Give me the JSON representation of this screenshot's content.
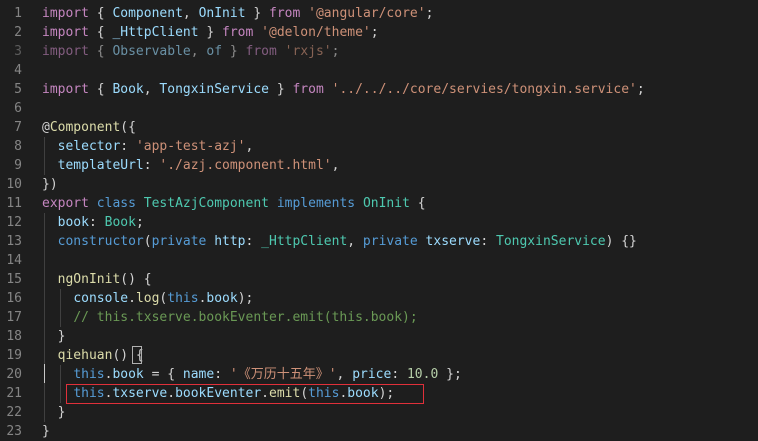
{
  "colors": {
    "background": "#1e1e1e",
    "line_number": "#858585",
    "keyword": "#569cd6",
    "control_keyword": "#c586c0",
    "string": "#ce9178",
    "type": "#4ec9b0",
    "variable": "#9cdcfe",
    "function": "#dcdcaa",
    "number": "#b5cea8",
    "comment": "#6a9955",
    "plain": "#d4d4d4",
    "highlight_box": "#e0303a"
  },
  "lines": [
    {
      "num": "1",
      "tokens": [
        {
          "t": "import",
          "c": "control_keyword"
        },
        {
          "t": " { ",
          "c": "plain"
        },
        {
          "t": "Component",
          "c": "variable"
        },
        {
          "t": ", ",
          "c": "plain"
        },
        {
          "t": "OnInit",
          "c": "variable"
        },
        {
          "t": " } ",
          "c": "plain"
        },
        {
          "t": "from",
          "c": "control_keyword"
        },
        {
          "t": " ",
          "c": "plain"
        },
        {
          "t": "'@angular/core'",
          "c": "string"
        },
        {
          "t": ";",
          "c": "plain"
        }
      ]
    },
    {
      "num": "2",
      "tokens": [
        {
          "t": "import",
          "c": "control_keyword"
        },
        {
          "t": " { ",
          "c": "plain"
        },
        {
          "t": "_HttpClient",
          "c": "variable"
        },
        {
          "t": " } ",
          "c": "plain"
        },
        {
          "t": "from",
          "c": "control_keyword"
        },
        {
          "t": " ",
          "c": "plain"
        },
        {
          "t": "'@delon/theme'",
          "c": "string"
        },
        {
          "t": ";",
          "c": "plain"
        }
      ]
    },
    {
      "num": "3",
      "dim": true,
      "tokens": [
        {
          "t": "import",
          "c": "control_keyword"
        },
        {
          "t": " { ",
          "c": "plain"
        },
        {
          "t": "Observable",
          "c": "variable"
        },
        {
          "t": ", ",
          "c": "plain"
        },
        {
          "t": "of",
          "c": "variable"
        },
        {
          "t": " } ",
          "c": "plain"
        },
        {
          "t": "from",
          "c": "control_keyword"
        },
        {
          "t": " ",
          "c": "plain"
        },
        {
          "t": "'rxjs'",
          "c": "string"
        },
        {
          "t": ";",
          "c": "plain"
        }
      ]
    },
    {
      "num": "4",
      "tokens": []
    },
    {
      "num": "5",
      "tokens": [
        {
          "t": "import",
          "c": "control_keyword"
        },
        {
          "t": " { ",
          "c": "plain"
        },
        {
          "t": "Book",
          "c": "variable"
        },
        {
          "t": ", ",
          "c": "plain"
        },
        {
          "t": "TongxinService",
          "c": "variable"
        },
        {
          "t": " } ",
          "c": "plain"
        },
        {
          "t": "from",
          "c": "control_keyword"
        },
        {
          "t": " ",
          "c": "plain"
        },
        {
          "t": "'../../../core/servies/tongxin.service'",
          "c": "string"
        },
        {
          "t": ";",
          "c": "plain"
        }
      ]
    },
    {
      "num": "6",
      "tokens": []
    },
    {
      "num": "7",
      "tokens": [
        {
          "t": "@",
          "c": "plain"
        },
        {
          "t": "Component",
          "c": "function"
        },
        {
          "t": "({",
          "c": "plain"
        }
      ]
    },
    {
      "num": "8",
      "tokens": [
        {
          "t": "  ",
          "c": "plain"
        },
        {
          "t": "selector",
          "c": "variable"
        },
        {
          "t": ": ",
          "c": "plain"
        },
        {
          "t": "'app-test-azj'",
          "c": "string"
        },
        {
          "t": ",",
          "c": "plain"
        }
      ]
    },
    {
      "num": "9",
      "tokens": [
        {
          "t": "  ",
          "c": "plain"
        },
        {
          "t": "templateUrl",
          "c": "variable"
        },
        {
          "t": ": ",
          "c": "plain"
        },
        {
          "t": "'./azj.component.html'",
          "c": "string"
        },
        {
          "t": ",",
          "c": "plain"
        }
      ]
    },
    {
      "num": "10",
      "tokens": [
        {
          "t": "})",
          "c": "plain"
        }
      ]
    },
    {
      "num": "11",
      "tokens": [
        {
          "t": "export",
          "c": "control_keyword"
        },
        {
          "t": " ",
          "c": "plain"
        },
        {
          "t": "class",
          "c": "keyword"
        },
        {
          "t": " ",
          "c": "plain"
        },
        {
          "t": "TestAzjComponent",
          "c": "type"
        },
        {
          "t": " ",
          "c": "plain"
        },
        {
          "t": "implements",
          "c": "keyword"
        },
        {
          "t": " ",
          "c": "plain"
        },
        {
          "t": "OnInit",
          "c": "type"
        },
        {
          "t": " {",
          "c": "plain"
        }
      ]
    },
    {
      "num": "12",
      "tokens": [
        {
          "t": "  ",
          "c": "plain"
        },
        {
          "t": "book",
          "c": "variable"
        },
        {
          "t": ": ",
          "c": "plain"
        },
        {
          "t": "Book",
          "c": "type"
        },
        {
          "t": ";",
          "c": "plain"
        }
      ]
    },
    {
      "num": "13",
      "tokens": [
        {
          "t": "  ",
          "c": "plain"
        },
        {
          "t": "constructor",
          "c": "keyword"
        },
        {
          "t": "(",
          "c": "plain"
        },
        {
          "t": "private",
          "c": "keyword"
        },
        {
          "t": " ",
          "c": "plain"
        },
        {
          "t": "http",
          "c": "variable"
        },
        {
          "t": ": ",
          "c": "plain"
        },
        {
          "t": "_HttpClient",
          "c": "type"
        },
        {
          "t": ", ",
          "c": "plain"
        },
        {
          "t": "private",
          "c": "keyword"
        },
        {
          "t": " ",
          "c": "plain"
        },
        {
          "t": "txserve",
          "c": "variable"
        },
        {
          "t": ": ",
          "c": "plain"
        },
        {
          "t": "TongxinService",
          "c": "type"
        },
        {
          "t": ") {}",
          "c": "plain"
        }
      ]
    },
    {
      "num": "14",
      "tokens": []
    },
    {
      "num": "15",
      "tokens": [
        {
          "t": "  ",
          "c": "plain"
        },
        {
          "t": "ngOnInit",
          "c": "function"
        },
        {
          "t": "() {",
          "c": "plain"
        }
      ]
    },
    {
      "num": "16",
      "tokens": [
        {
          "t": "    ",
          "c": "plain"
        },
        {
          "t": "console",
          "c": "variable"
        },
        {
          "t": ".",
          "c": "plain"
        },
        {
          "t": "log",
          "c": "function"
        },
        {
          "t": "(",
          "c": "plain"
        },
        {
          "t": "this",
          "c": "keyword"
        },
        {
          "t": ".",
          "c": "plain"
        },
        {
          "t": "book",
          "c": "variable"
        },
        {
          "t": ");",
          "c": "plain"
        }
      ]
    },
    {
      "num": "17",
      "tokens": [
        {
          "t": "    ",
          "c": "plain"
        },
        {
          "t": "// this.txserve.bookEventer.emit(this.book);",
          "c": "comment"
        }
      ]
    },
    {
      "num": "18",
      "tokens": [
        {
          "t": "  }",
          "c": "plain"
        }
      ]
    },
    {
      "num": "19",
      "tokens": [
        {
          "t": "  ",
          "c": "plain"
        },
        {
          "t": "qiehuan",
          "c": "function"
        },
        {
          "t": "() {",
          "c": "plain"
        }
      ]
    },
    {
      "num": "20",
      "tokens": [
        {
          "t": "    ",
          "c": "plain"
        },
        {
          "t": "this",
          "c": "keyword"
        },
        {
          "t": ".",
          "c": "plain"
        },
        {
          "t": "book",
          "c": "variable"
        },
        {
          "t": " = { ",
          "c": "plain"
        },
        {
          "t": "name",
          "c": "variable"
        },
        {
          "t": ": ",
          "c": "plain"
        },
        {
          "t": "'《万历十五年》'",
          "c": "string"
        },
        {
          "t": ", ",
          "c": "plain"
        },
        {
          "t": "price",
          "c": "variable"
        },
        {
          "t": ": ",
          "c": "plain"
        },
        {
          "t": "10.0",
          "c": "number"
        },
        {
          "t": " };",
          "c": "plain"
        }
      ]
    },
    {
      "num": "21",
      "tokens": [
        {
          "t": "    ",
          "c": "plain"
        },
        {
          "t": "this",
          "c": "keyword"
        },
        {
          "t": ".",
          "c": "plain"
        },
        {
          "t": "txserve",
          "c": "variable"
        },
        {
          "t": ".",
          "c": "plain"
        },
        {
          "t": "bookEventer",
          "c": "variable"
        },
        {
          "t": ".",
          "c": "plain"
        },
        {
          "t": "emit",
          "c": "function"
        },
        {
          "t": "(",
          "c": "plain"
        },
        {
          "t": "this",
          "c": "keyword"
        },
        {
          "t": ".",
          "c": "plain"
        },
        {
          "t": "book",
          "c": "variable"
        },
        {
          "t": ");",
          "c": "plain"
        }
      ]
    },
    {
      "num": "22",
      "tokens": [
        {
          "t": "  }",
          "c": "plain"
        }
      ]
    },
    {
      "num": "23",
      "tokens": [
        {
          "t": "}",
          "c": "plain"
        }
      ]
    }
  ]
}
